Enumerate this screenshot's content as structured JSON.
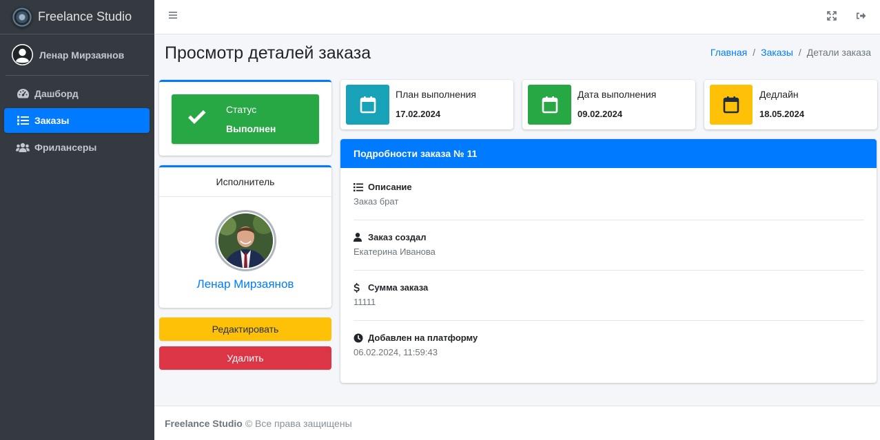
{
  "brand": {
    "name": "Freelance Studio"
  },
  "user": {
    "name": "Ленар Мирзаянов"
  },
  "sidebar": {
    "items": [
      {
        "label": "Дашборд",
        "icon": "tachometer-icon",
        "active": false
      },
      {
        "label": "Заказы",
        "icon": "list-icon",
        "active": true
      },
      {
        "label": "Фрилансеры",
        "icon": "users-icon",
        "active": false
      }
    ]
  },
  "header": {
    "title": "Просмотр деталей заказа",
    "breadcrumb": [
      "Главная",
      "Заказы",
      "Детали заказа"
    ],
    "breadcrumb_sep": "/"
  },
  "status": {
    "label": "Статус",
    "value": "Выполнен",
    "color": "#28a745"
  },
  "executor": {
    "header": "Исполнитель",
    "name": "Ленар Мирзаянов"
  },
  "actions": {
    "edit": "Редактировать",
    "delete": "Удалить"
  },
  "info_boxes": [
    {
      "label": "План выполнения",
      "value": "17.02.2024",
      "color": "#17a2b8",
      "icon": "calendar-icon"
    },
    {
      "label": "Дата выполнения",
      "value": "09.02.2024",
      "color": "#28a745",
      "icon": "calendar-icon"
    },
    {
      "label": "Дедлайн",
      "value": "18.05.2024",
      "color": "#ffc107",
      "icon": "calendar-icon"
    }
  ],
  "details": {
    "title": "Подробности заказа №",
    "number": "11",
    "fields": [
      {
        "label": "Описание",
        "value": "Заказ брат",
        "icon": "list-icon"
      },
      {
        "label": "Заказ создал",
        "value": "Екатерина Иванова",
        "icon": "user-icon"
      },
      {
        "label": "Сумма заказа",
        "value": "11111",
        "icon": "dollar-icon"
      },
      {
        "label": "Добавлен на платформу",
        "value": "06.02.2024, 11:59:43",
        "icon": "clock-icon"
      }
    ]
  },
  "footer": {
    "brand": "Freelance Studio",
    "text": "© Все права защищены"
  },
  "colors": {
    "primary": "#007bff",
    "sidebar": "#343a40",
    "danger": "#dc3545",
    "warning": "#ffc107",
    "info": "#17a2b8",
    "success": "#28a745"
  }
}
